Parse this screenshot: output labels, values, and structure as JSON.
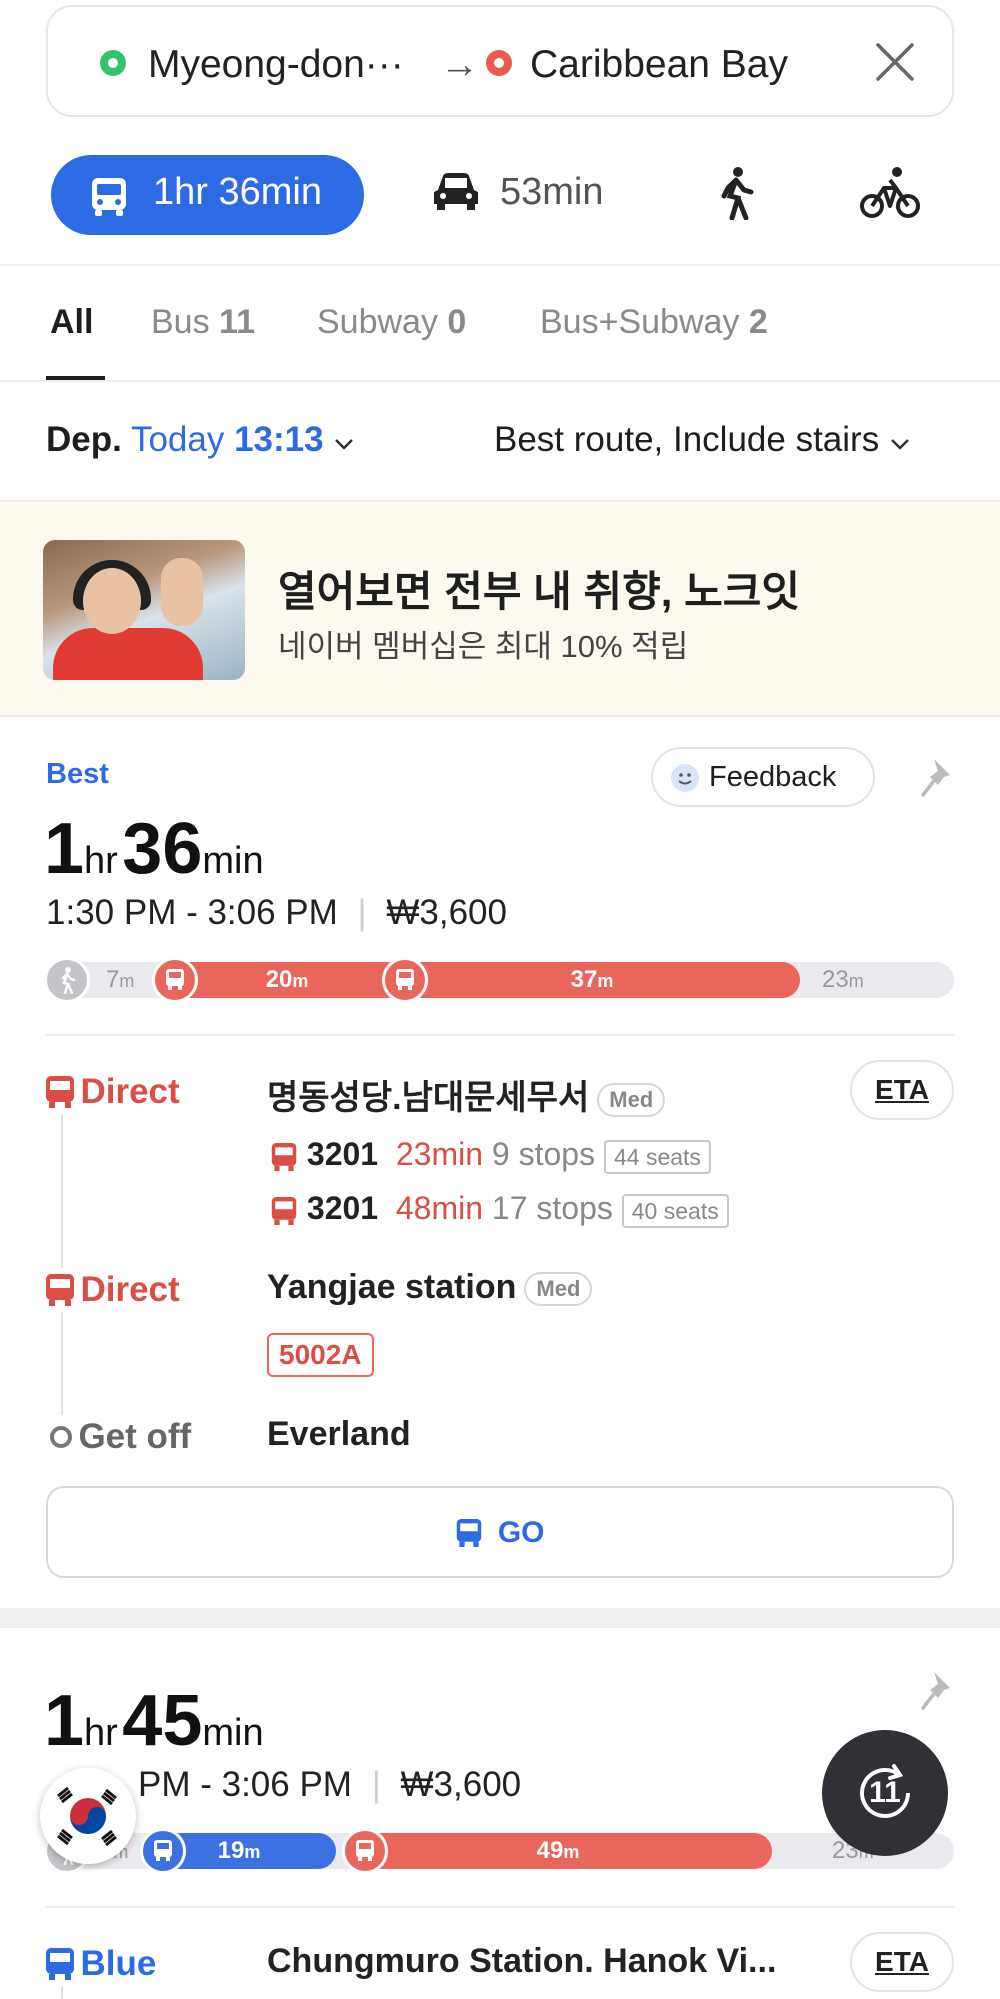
{
  "search": {
    "origin": "Myeong-don···",
    "arrow": "→",
    "destination": "Caribbean Bay"
  },
  "modes": [
    {
      "label": "1hr 36min",
      "icon": "bus-icon",
      "active": true
    },
    {
      "label": "53min",
      "icon": "car-icon"
    },
    {
      "label": "",
      "icon": "walk-icon"
    },
    {
      "label": "",
      "icon": "bicycle-icon"
    }
  ],
  "filter_tabs": [
    {
      "label": "All"
    },
    {
      "label": "Bus",
      "count": "11"
    },
    {
      "label": "Subway",
      "count": "0"
    },
    {
      "label": "Bus+Subway",
      "count": "2"
    }
  ],
  "departure": {
    "prefix": "Dep.",
    "day": "Today",
    "time": "13:13",
    "options": "Best route, Include stairs"
  },
  "ad": {
    "headline": "열어보면 전부 내 취향, 노크잇",
    "subline": "네이버 멤버십은 최대 10% 적립"
  },
  "routes": [
    {
      "tag": "Best",
      "feedback": "Feedback",
      "hours": "1",
      "hr_unit": "hr",
      "minutes": "36",
      "min_unit": "min",
      "time_range": "1:30 PM - 3:06 PM",
      "fare": "₩3,600",
      "segments": {
        "walk1": "7",
        "bus1": "20",
        "bus2": "37",
        "walk2": "23",
        "unit": "m"
      },
      "steps": [
        {
          "label": "Direct",
          "stop": "명동성당.남대문세무서",
          "badge": "Med",
          "eta": "ETA",
          "buses": [
            {
              "num": "3201",
              "min": "23min",
              "stops": "9 stops",
              "seats": "44 seats"
            },
            {
              "num": "3201",
              "min": "48min",
              "stops": "17 stops",
              "seats": "40 seats"
            }
          ]
        },
        {
          "label": "Direct",
          "stop": "Yangjae station",
          "badge": "Med",
          "route": "5002A"
        },
        {
          "label": "Get off",
          "stop": "Everland"
        }
      ],
      "go": "GO"
    },
    {
      "hours": "1",
      "hr_unit": "hr",
      "minutes": "45",
      "min_unit": "min",
      "time_range": "1:21 PM - 3:06 PM",
      "time_range_visible": "PM - 3:06 PM",
      "fare": "₩3,600",
      "segments": {
        "walk1": "5",
        "bus1": "19",
        "bus2": "49",
        "walk2": "23",
        "unit": "m"
      },
      "steps": [
        {
          "label": "Blue",
          "stop": "Chungmuro Station. Hanok Vi...",
          "eta": "ETA"
        }
      ]
    }
  ],
  "fab": {
    "label": "11"
  }
}
